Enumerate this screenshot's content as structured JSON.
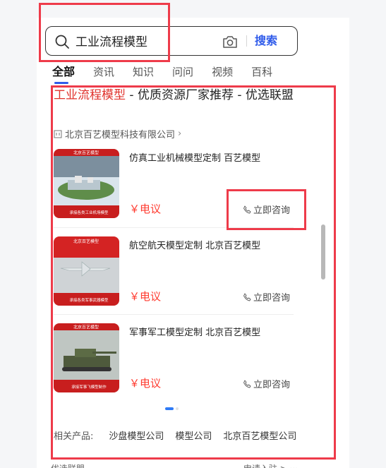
{
  "search": {
    "query": "工业流程模型",
    "button_label": "搜索"
  },
  "tabs": [
    {
      "label": "全部",
      "active": true
    },
    {
      "label": "资讯",
      "active": false
    },
    {
      "label": "知识",
      "active": false
    },
    {
      "label": "问问",
      "active": false
    },
    {
      "label": "视频",
      "active": false
    },
    {
      "label": "百科",
      "active": false
    }
  ],
  "result": {
    "title_highlight": "工业流程模型",
    "title_rest": " - 优质资源厂家推荐 - 优选联盟",
    "company": "北京百艺模型科技有限公司"
  },
  "products": [
    {
      "name": "仿真工业机械模型定制 百艺模型",
      "price": "￥电议",
      "consult": "立即咨询",
      "banner": "北京百艺模型",
      "badge": "承接各类工业机场模型"
    },
    {
      "name": "航空航天模型定制 北京百艺模型",
      "price": "￥电议",
      "consult": "立即咨询",
      "banner": "北京百艺模型",
      "badge": "承接各类军事武器模型"
    },
    {
      "name": "军事军工模型定制 北京百艺模型",
      "price": "￥电议",
      "consult": "立即咨询",
      "banner": "北京百艺模型",
      "badge": "承接军事飞模型制作"
    }
  ],
  "related": {
    "label": "相关产品:",
    "items": [
      "沙盘模型公司",
      "模型公司",
      "北京百艺模型公司"
    ]
  },
  "footer": {
    "left": "优选联盟",
    "right": "申请入驻 >  ···"
  },
  "colors": {
    "accent": "#2f5bea",
    "highlight": "#e0322c",
    "price": "#ff3b30",
    "annotation": "#ee3b4a"
  }
}
